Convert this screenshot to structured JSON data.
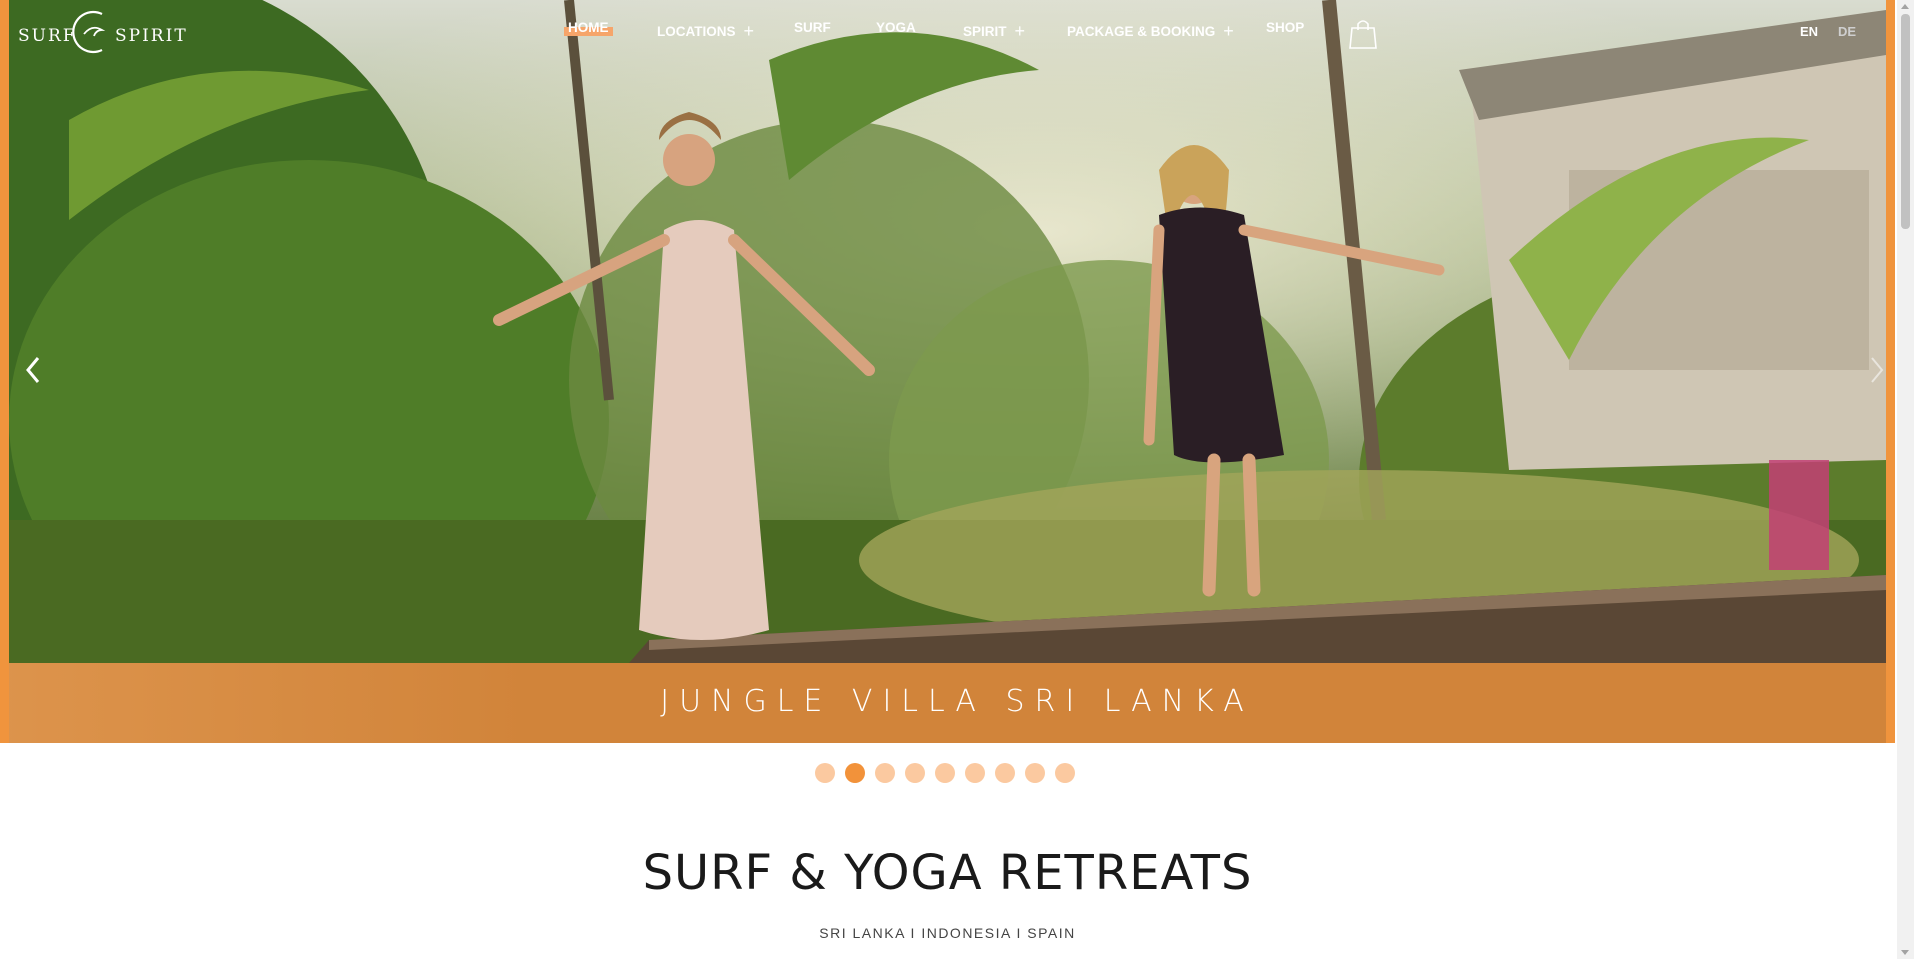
{
  "brand": {
    "left_word": "SURF",
    "right_word": "SPIRIT"
  },
  "nav": {
    "items": [
      {
        "label": "HOME",
        "has_submenu": false,
        "active": true
      },
      {
        "label": "LOCATIONS",
        "has_submenu": true
      },
      {
        "label": "SURF",
        "has_submenu": false
      },
      {
        "label": "YOGA",
        "has_submenu": false
      },
      {
        "label": "SPIRIT",
        "has_submenu": true
      },
      {
        "label": "PACKAGE & BOOKING",
        "has_submenu": true
      },
      {
        "label": "SHOP",
        "has_submenu": false
      }
    ],
    "submenu_symbol": "+",
    "cart_icon": "shopping-bag-icon",
    "languages": [
      {
        "code": "EN",
        "active": true
      },
      {
        "code": "DE",
        "active": false
      }
    ]
  },
  "hero": {
    "caption": "JUNGLE VILLA SRI LANKA",
    "prev_icon": "chevron-left-icon",
    "next_icon": "chevron-right-icon",
    "slide_count": 9,
    "active_slide": 2
  },
  "main": {
    "headline": "SURF & YOGA RETREATS",
    "subline": "SRI LANKA I INDONESIA I SPAIN"
  },
  "colors": {
    "accent": "#f0943d",
    "caption_band": "#d1843a",
    "dot_inactive": "#fbc9a0",
    "dot_active": "#f2923a",
    "highlight": "#f6a56a"
  }
}
